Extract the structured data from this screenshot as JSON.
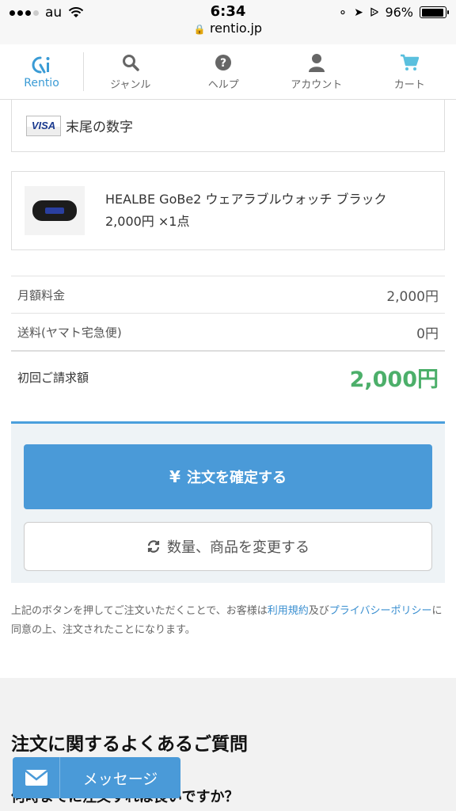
{
  "status_bar": {
    "carrier": "au",
    "time": "6:34",
    "url": "rentio.jp",
    "battery": "96%",
    "battery_level": 0.96
  },
  "nav": {
    "logo_text": "Rentio",
    "logo_mark": "Ri",
    "items": [
      {
        "label": "ジャンル",
        "icon": "search-icon"
      },
      {
        "label": "ヘルプ",
        "icon": "help-icon"
      },
      {
        "label": "アカウント",
        "icon": "account-icon"
      },
      {
        "label": "カート",
        "icon": "cart-icon"
      }
    ]
  },
  "payment": {
    "card_brand": "VISA",
    "card_label": "末尾の数字"
  },
  "product": {
    "name": "HEALBE GoBe2 ウェアラブルウォッチ ブラック",
    "price_qty": "2,000円 ×1点"
  },
  "summary": {
    "monthly_label": "月額料金",
    "monthly_value": "2,000円",
    "shipping_label": "送料(ヤマト宅急便)",
    "shipping_value": "0円",
    "total_label": "初回ご請求額",
    "total_value": "2,000円"
  },
  "actions": {
    "confirm_label": "注文を確定する",
    "change_label": "数量、商品を変更する"
  },
  "notice": {
    "text_1": "上記のボタンを押してご注文いただくことで、お客様は",
    "terms_link": "利用規約",
    "text_2": "及び",
    "privacy_link": "プライバシーポリシー",
    "text_3": "に同意の上、注文されたことになります。"
  },
  "faq": {
    "title": "注文に関するよくあるご質問",
    "question": "何時までに注文すれば良いですか？"
  },
  "message_button": {
    "label": "メッセージ"
  },
  "colors": {
    "accent_blue": "#4a9ad8",
    "total_green": "#4caf6a"
  }
}
